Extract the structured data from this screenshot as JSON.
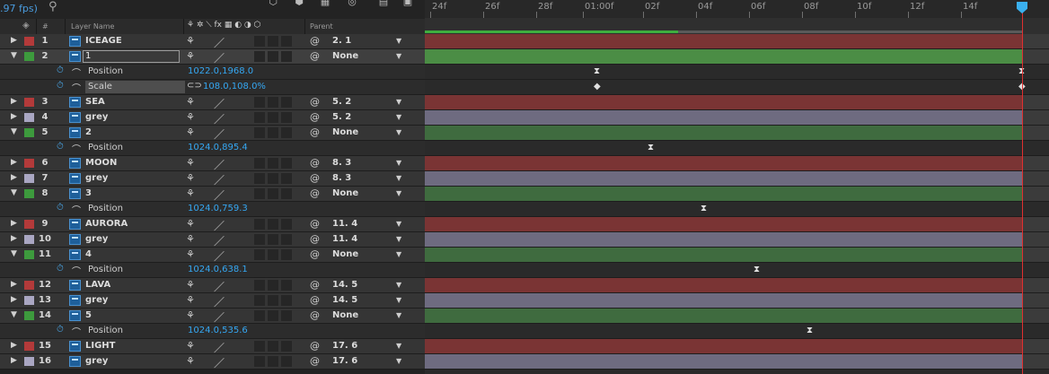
{
  "toolbar": {
    "fps": ".97 fps)",
    "icons": [
      "search-icon",
      "cube-icon",
      "grid-icon",
      "motion-blur-icon",
      "graph-icon",
      "brainstorm-icon"
    ]
  },
  "columns": {
    "number": "#",
    "layer_name": "Layer Name",
    "parent": "Parent",
    "switch_glyphs": "⚘ ✲ ⟍ fx ▦ ◐ ◑ ⬡"
  },
  "layers": [
    {
      "kind": "layer",
      "num": "1",
      "name": "ICEAGE",
      "color": "#b33a3a",
      "twirl": "▶",
      "parent": "2. 1"
    },
    {
      "kind": "layer",
      "num": "2",
      "name": "1",
      "color": "#3d9a3d",
      "twirl": "▼",
      "parent": "None",
      "selected": true,
      "editing": true
    },
    {
      "kind": "prop",
      "name": "Position",
      "value": "1022.0,1968.0"
    },
    {
      "kind": "prop",
      "name": "Scale",
      "value": "108.0,108.0%",
      "linked": true,
      "highlight": true
    },
    {
      "kind": "layer",
      "num": "3",
      "name": "SEA",
      "color": "#b33a3a",
      "twirl": "▶",
      "parent": "5. 2"
    },
    {
      "kind": "layer",
      "num": "4",
      "name": "grey",
      "color": "#a9a6c2",
      "twirl": "▶",
      "parent": "5. 2"
    },
    {
      "kind": "layer",
      "num": "5",
      "name": "2",
      "color": "#3d9a3d",
      "twirl": "▼",
      "parent": "None"
    },
    {
      "kind": "prop",
      "name": "Position",
      "value": "1024.0,895.4"
    },
    {
      "kind": "layer",
      "num": "6",
      "name": "MOON",
      "color": "#b33a3a",
      "twirl": "▶",
      "parent": "8. 3"
    },
    {
      "kind": "layer",
      "num": "7",
      "name": "grey",
      "color": "#a9a6c2",
      "twirl": "▶",
      "parent": "8. 3"
    },
    {
      "kind": "layer",
      "num": "8",
      "name": "3",
      "color": "#3d9a3d",
      "twirl": "▼",
      "parent": "None"
    },
    {
      "kind": "prop",
      "name": "Position",
      "value": "1024.0,759.3"
    },
    {
      "kind": "layer",
      "num": "9",
      "name": "AURORA",
      "color": "#b33a3a",
      "twirl": "▶",
      "parent": "11. 4"
    },
    {
      "kind": "layer",
      "num": "10",
      "name": "grey",
      "color": "#a9a6c2",
      "twirl": "▶",
      "parent": "11. 4"
    },
    {
      "kind": "layer",
      "num": "11",
      "name": "4",
      "color": "#3d9a3d",
      "twirl": "▼",
      "parent": "None"
    },
    {
      "kind": "prop",
      "name": "Position",
      "value": "1024.0,638.1"
    },
    {
      "kind": "layer",
      "num": "12",
      "name": "LAVA",
      "color": "#b33a3a",
      "twirl": "▶",
      "parent": "14. 5"
    },
    {
      "kind": "layer",
      "num": "13",
      "name": "grey",
      "color": "#a9a6c2",
      "twirl": "▶",
      "parent": "14. 5"
    },
    {
      "kind": "layer",
      "num": "14",
      "name": "5",
      "color": "#3d9a3d",
      "twirl": "▼",
      "parent": "None"
    },
    {
      "kind": "prop",
      "name": "Position",
      "value": "1024.0,535.6"
    },
    {
      "kind": "layer",
      "num": "15",
      "name": "LIGHT",
      "color": "#b33a3a",
      "twirl": "▶",
      "parent": "17. 6"
    },
    {
      "kind": "layer",
      "num": "16",
      "name": "grey",
      "color": "#a9a6c2",
      "twirl": "▶",
      "parent": "17. 6"
    }
  ],
  "ruler": {
    "labels": [
      "24f",
      "26f",
      "28f",
      "01:00f",
      "02f",
      "04f",
      "06f",
      "08f",
      "10f",
      "12f",
      "14f"
    ]
  },
  "glyphs": {
    "keyframe_hold": "⧗",
    "keyframe_diamond": "◆",
    "stopwatch": "⏱",
    "graph": "⌒",
    "link": "⊂⊃",
    "shy": "⚘",
    "quality": "／",
    "pickwhip": "@",
    "dropdown": "▼"
  }
}
